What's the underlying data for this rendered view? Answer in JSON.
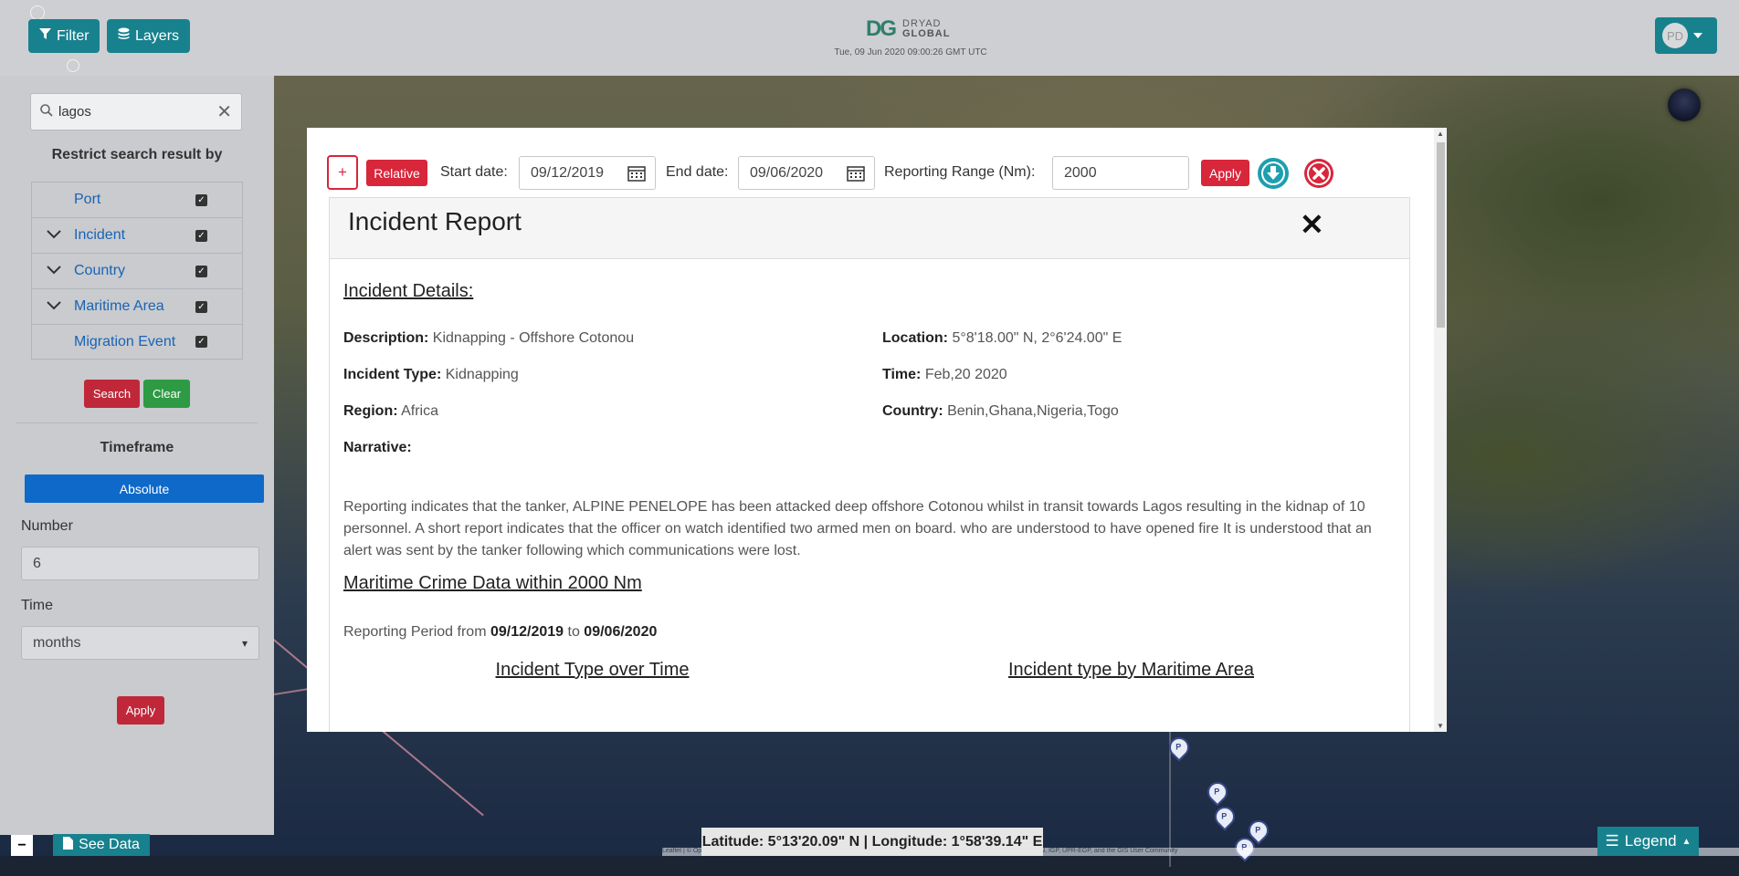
{
  "topbar": {
    "filter_label": "Filter",
    "layers_label": "Layers",
    "logo_mark": "DG",
    "logo_line1": "DRYAD",
    "logo_line2": "GLOBAL",
    "clock": "Tue, 09 Jun 2020 09:00:26 GMT UTC",
    "user_initials": "PD"
  },
  "sidebar": {
    "search_value": "lagos",
    "restrict_title": "Restrict search result by",
    "filters": [
      {
        "label": "Port",
        "expandable": false,
        "checked": true
      },
      {
        "label": "Incident",
        "expandable": true,
        "checked": true
      },
      {
        "label": "Country",
        "expandable": true,
        "checked": true
      },
      {
        "label": "Maritime Area",
        "expandable": true,
        "checked": true
      },
      {
        "label": "Migration Event",
        "expandable": false,
        "checked": true
      }
    ],
    "search_btn": "Search",
    "clear_btn": "Clear",
    "timeframe_title": "Timeframe",
    "absolute_btn": "Absolute",
    "number_label": "Number",
    "number_value": "6",
    "time_label": "Time",
    "time_value": "months",
    "apply_btn": "Apply",
    "see_data": "See Data"
  },
  "map": {
    "latlon": "Latitude: 5°13'20.09\" N | Longitude: 1°58'39.14\" E",
    "legend": "Legend",
    "attribution": "Leaflet | © OpenStreetMap contributors, Tiles © Esri — Source: Esri, i-cubed, USDA, USGS, AEX, GeoEye, Getmapping, Aerogrid, IGN, IGP, UPR-EGP, and the GIS User Community"
  },
  "modal": {
    "plus_btn": "+",
    "relative_btn": "Relative",
    "start_label": "Start date:",
    "start_value": "09/12/2019",
    "end_label": "End date:",
    "end_value": "09/06/2020",
    "range_label": "Reporting Range (Nm):",
    "range_value": "2000",
    "apply_btn": "Apply",
    "title": "Incident Report",
    "details_heading": "Incident Details:",
    "description_k": "Description:",
    "description_v": "Kidnapping - Offshore Cotonou",
    "location_k": "Location:",
    "location_v": "5°8'18.00\" N, 2°6'24.00\" E",
    "type_k": "Incident Type:",
    "type_v": "Kidnapping",
    "time_k": "Time:",
    "time_v": "Feb,20 2020",
    "region_k": "Region:",
    "region_v": "Africa",
    "country_k": "Country:",
    "country_v": "Benin,Ghana,Nigeria,Togo",
    "narrative_k": "Narrative:",
    "narrative": "Reporting indicates that the tanker, ALPINE PENELOPE has been attacked deep offshore Cotonou whilst in transit towards Lagos resulting in the kidnap of 10 personnel. A short report indicates that the officer on watch identified two armed men on board. who are understood to have opened fire It is understood that an alert was sent by the tanker following which communications were lost.",
    "maritime_heading": "Maritime Crime Data within 2000 Nm",
    "period_prefix": "Reporting Period from",
    "period_from": "09/12/2019",
    "period_to_word": "to",
    "period_to": "09/06/2020",
    "chart1_title": "Incident Type over Time",
    "chart2_title": "Incident type by Maritime Area"
  },
  "colors": {
    "teal": "#18818e",
    "red": "#d8263b",
    "blue": "#0f69c9",
    "green": "#2e9a44",
    "link": "#1a63b4"
  }
}
